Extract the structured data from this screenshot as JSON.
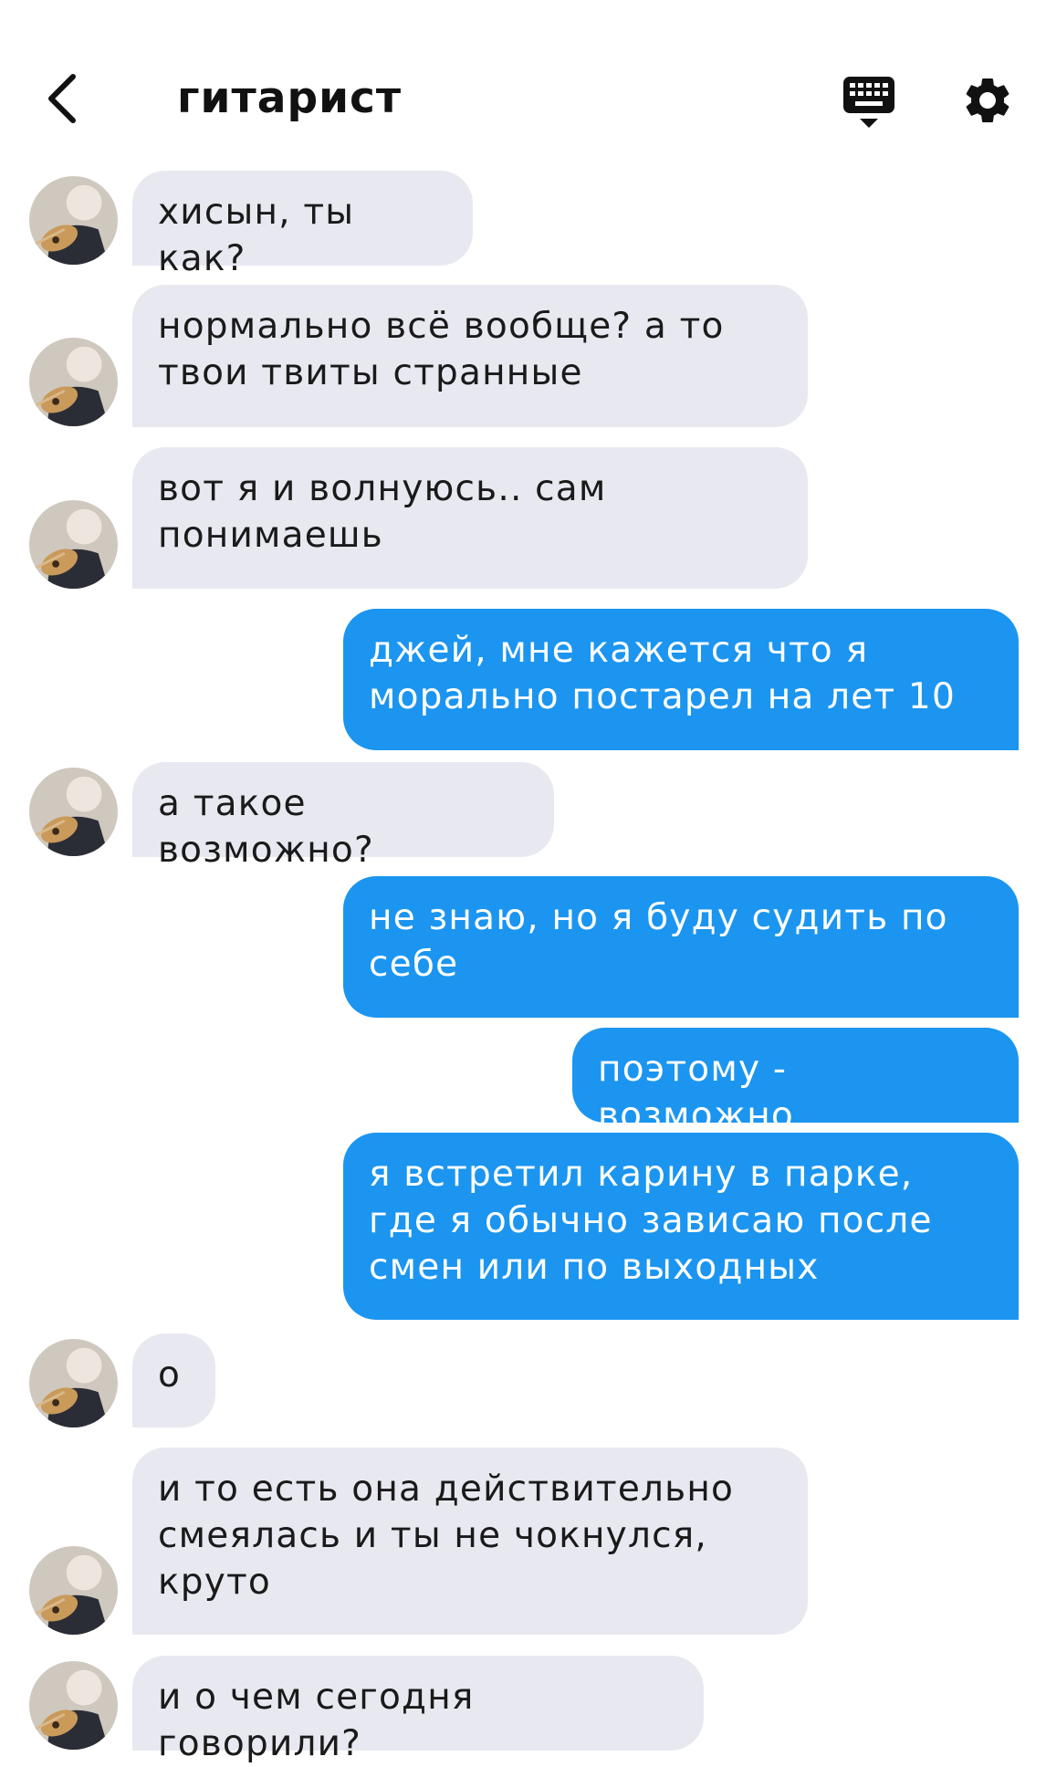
{
  "header": {
    "title": "гитарист",
    "back_icon": "chevron-left-icon",
    "keyboard_icon": "keyboard-icon",
    "settings_icon": "gear-icon"
  },
  "colors": {
    "incoming_bubble": "#e8e9f0",
    "outgoing_bubble": "#1b95f0",
    "outgoing_text": "#ffffff"
  },
  "messages": [
    {
      "side": "in",
      "text": "хисын, ты как?"
    },
    {
      "side": "in",
      "text": "нормально всё вообще? а то твои твиты странные"
    },
    {
      "side": "in",
      "text": "вот я и волнуюсь.. сам понимаешь"
    },
    {
      "side": "out",
      "text": "джей, мне кажется что я морально постарел на лет 10"
    },
    {
      "side": "in",
      "text": "а такое возможно?"
    },
    {
      "side": "out",
      "text": "не знаю, но я буду судить по себе"
    },
    {
      "side": "out",
      "text": "поэтому - возможно"
    },
    {
      "side": "out",
      "text": "я встретил карину в парке, где я обычно зависаю после смен или по выходных"
    },
    {
      "side": "in",
      "text": "о"
    },
    {
      "side": "in",
      "text": "и то есть она действительно смеялась и ты не чокнулся, круто"
    },
    {
      "side": "in",
      "text": "и о чем сегодня говорили?"
    }
  ]
}
